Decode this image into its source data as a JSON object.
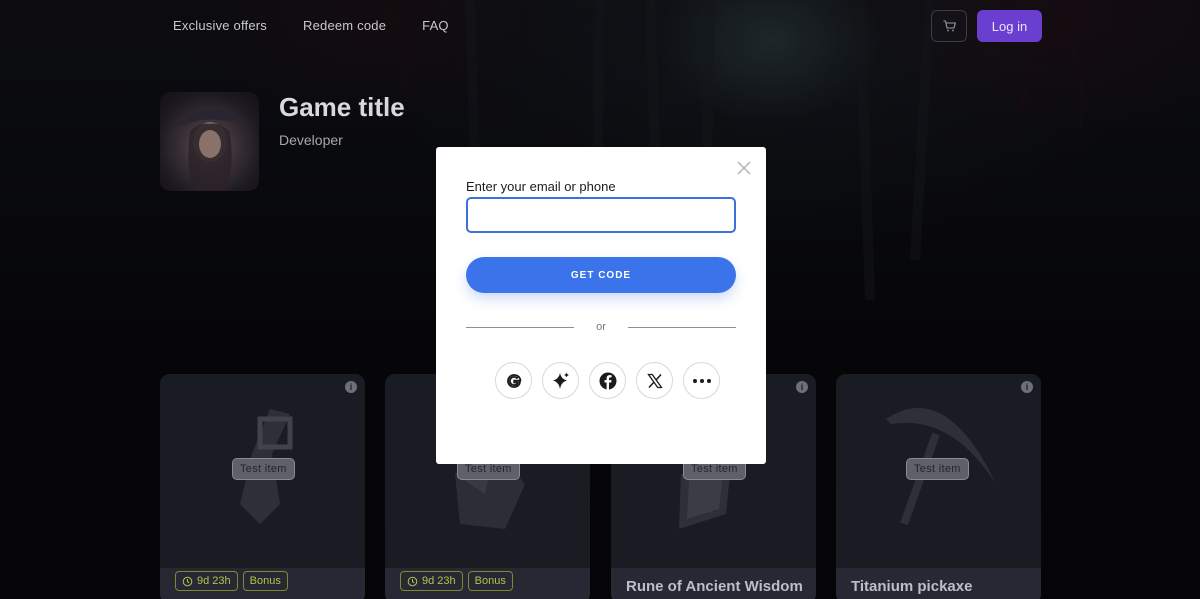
{
  "header": {
    "nav": [
      "Exclusive offers",
      "Redeem code",
      "FAQ"
    ],
    "login_label": "Log in"
  },
  "game": {
    "title": "Game title",
    "developer": "Developer"
  },
  "items": [
    {
      "tag": "Test item",
      "timer": "9d 23h",
      "bonus": "Bonus",
      "name": ""
    },
    {
      "tag": "Test item",
      "timer": "9d 23h",
      "bonus": "Bonus",
      "name": ""
    },
    {
      "tag": "Test item",
      "timer": "",
      "bonus": "",
      "name": "Rune of Ancient Wisdom"
    },
    {
      "tag": "Test item",
      "timer": "",
      "bonus": "",
      "name": "Titanium pickaxe"
    }
  ],
  "modal": {
    "field_label": "Enter your email or phone",
    "input_value": "",
    "get_code_label": "GET CODE",
    "or_label": "or",
    "socials": [
      "google-icon",
      "sparkle-icon",
      "facebook-icon",
      "x-icon",
      "more-icon"
    ]
  },
  "colors": {
    "accent": "#3a73ea",
    "login": "#6a3fd0",
    "badge": "#b5c24d"
  }
}
